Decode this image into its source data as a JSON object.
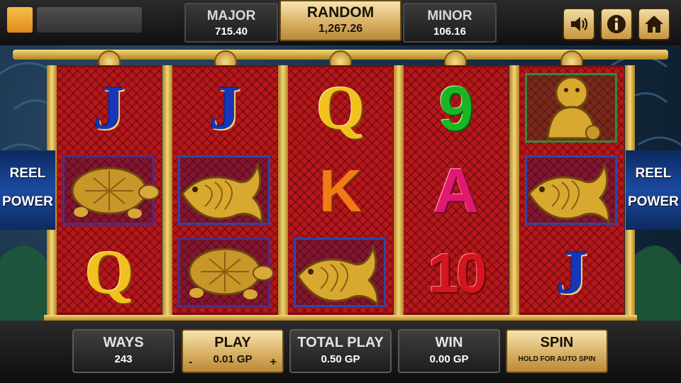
{
  "jackpots": {
    "major": {
      "label": "MAJOR",
      "value": "715.40"
    },
    "random": {
      "label": "RANDOM",
      "value": "1,267.26"
    },
    "minor": {
      "label": "MINOR",
      "value": "106.16"
    }
  },
  "icons": {
    "sound": "speaker-icon",
    "info": "info-icon",
    "home": "home-icon"
  },
  "side_panels": {
    "left": [
      "REEL",
      "POWER"
    ],
    "right": [
      "REEL",
      "POWER"
    ]
  },
  "reels": [
    {
      "symbols": [
        "J",
        "turtle",
        "Q"
      ]
    },
    {
      "symbols": [
        "J",
        "fish",
        "turtle"
      ]
    },
    {
      "symbols": [
        "Q",
        "K",
        "fish"
      ]
    },
    {
      "symbols": [
        "9",
        "A",
        "10"
      ]
    },
    {
      "symbols": [
        "foo-dog",
        "fish",
        "J"
      ]
    }
  ],
  "controls": {
    "ways": {
      "label": "WAYS",
      "value": "243"
    },
    "play": {
      "label": "PLAY",
      "value": "0.01 GP",
      "minus": "-",
      "plus": "+"
    },
    "total_play": {
      "label": "TOTAL PLAY",
      "value": "0.50 GP"
    },
    "win": {
      "label": "WIN",
      "value": "0.00 GP"
    },
    "spin": {
      "label": "SPIN",
      "sub": "HOLD FOR AUTO SPIN"
    }
  },
  "colors": {
    "reel_red": "#b8161a",
    "gold": "#d9b165",
    "card_blue": "#1537b8"
  }
}
